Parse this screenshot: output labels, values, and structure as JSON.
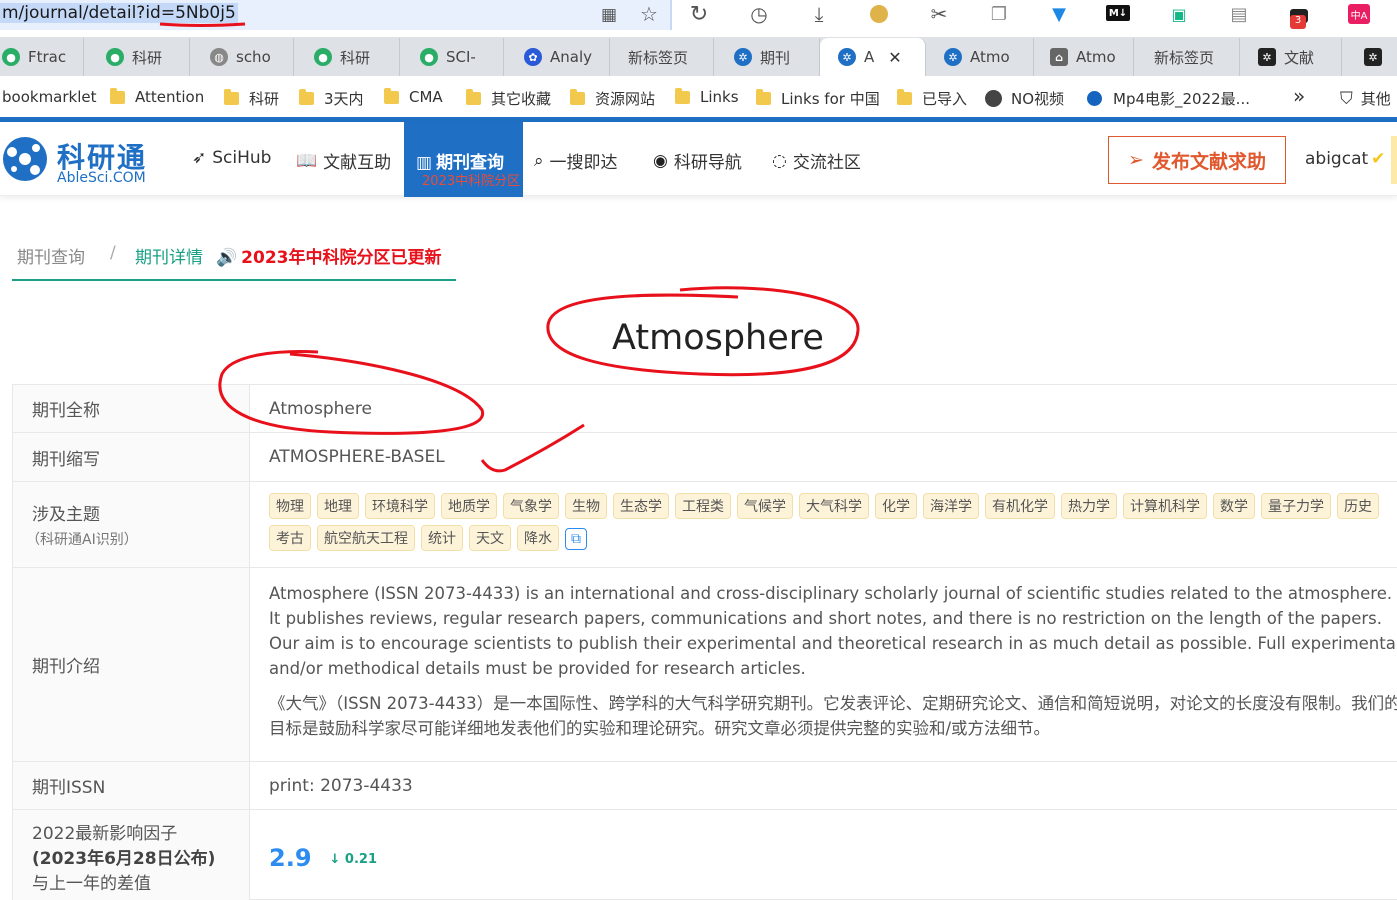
{
  "browser": {
    "url": "m/journal/detail?id=5Nb0j5",
    "tabs": [
      {
        "label": "Ftrac",
        "icon": "wechat-icon"
      },
      {
        "label": "科研",
        "icon": "wechat-icon"
      },
      {
        "label": "scho",
        "icon": "globe-icon"
      },
      {
        "label": "科研",
        "icon": "wechat-icon"
      },
      {
        "label": "SCI-",
        "icon": "wechat-icon"
      },
      {
        "label": "Analy",
        "icon": "baidu-icon"
      },
      {
        "label": "新标签页",
        "icon": ""
      },
      {
        "label": "期刊",
        "icon": "ablesci-icon"
      },
      {
        "label": "A",
        "icon": "ablesci-icon"
      },
      {
        "label": "Atmo",
        "icon": "ablesci-icon"
      },
      {
        "label": "Atmo",
        "icon": "lock-icon"
      },
      {
        "label": "新标签页",
        "icon": ""
      },
      {
        "label": "文献",
        "icon": "ablesci-icon"
      },
      {
        "label": "",
        "icon": "ablesci-icon"
      }
    ],
    "bookmarks": [
      {
        "label": "bookmarklet",
        "icon": ""
      },
      {
        "label": "Attention",
        "icon": "folder-icon"
      },
      {
        "label": "科研",
        "icon": "folder-icon"
      },
      {
        "label": "3天内",
        "icon": "folder-icon"
      },
      {
        "label": "CMA",
        "icon": "folder-icon"
      },
      {
        "label": "其它收藏",
        "icon": "folder-icon"
      },
      {
        "label": "资源网站",
        "icon": "folder-icon"
      },
      {
        "label": "Links",
        "icon": "folder-icon"
      },
      {
        "label": "Links for 中国",
        "icon": "folder-icon"
      },
      {
        "label": "已导入",
        "icon": "folder-icon"
      },
      {
        "label": "NO视频",
        "icon": "globe-icon"
      },
      {
        "label": "Mp4电影_2022最...",
        "icon": "globe-icon"
      },
      {
        "label": "其他",
        "icon": "folder-icon"
      }
    ]
  },
  "site": {
    "logo_cn": "科研通",
    "logo_en": "AbleSci.COM",
    "nav": [
      {
        "label": "SciHub",
        "icon": "bird-icon"
      },
      {
        "label": "文献互助",
        "icon": "book-icon"
      },
      {
        "label": "期刊查询",
        "sub": "2023中科院分区",
        "icon": "journal-icon"
      },
      {
        "label": "一搜即达",
        "icon": "search-icon"
      },
      {
        "label": "科研导航",
        "icon": "compass-icon"
      },
      {
        "label": "交流社区",
        "icon": "chat-icon"
      }
    ],
    "post_button": "发布文献求助",
    "username": "abigcat"
  },
  "breadcrumb": {
    "home": "期刊查询",
    "sep": "/",
    "current": "期刊详情",
    "notice": "2023年中科院分区已更新"
  },
  "journal": {
    "title": "Atmosphere",
    "rows": {
      "fullname_label": "期刊全称",
      "fullname": "Atmosphere",
      "abbr_label": "期刊缩写",
      "abbr": "ATMOSPHERE-BASEL",
      "topics_label": "涉及主题",
      "topics_sublabel": "（科研通AI识别）",
      "topics": [
        "物理",
        "地理",
        "环境科学",
        "地质学",
        "气象学",
        "生物",
        "生态学",
        "工程类",
        "气候学",
        "大气科学",
        "化学",
        "海洋学",
        "有机化学",
        "热力学",
        "计算机科学",
        "数学",
        "量子力学",
        "历史",
        "考古",
        "航空航天工程",
        "统计",
        "天文",
        "降水"
      ],
      "intro_label": "期刊介绍",
      "intro_en": "Atmosphere (ISSN 2073-4433) is an international and cross-disciplinary scholarly journal of scientific studies related to the atmosphere. It publishes reviews, regular research papers, communications and short notes, and there is no restriction on the length of the papers. Our aim is to encourage scientists to publish their experimental and theoretical research in as much detail as possible. Full experimental and/or methodical details must be provided for research articles.",
      "intro_cn": "《大气》（ISSN 2073-4433）是一本国际性、跨学科的大气科学研究期刊。它发表评论、定期研究论文、通信和简短说明，对论文的长度没有限制。我们的目标是鼓励科学家尽可能详细地发表他们的实验和理论研究。研究文章必须提供完整的实验和/或方法细节。",
      "issn_label": "期刊ISSN",
      "issn": "print: 2073-4433",
      "if_label_1": "2022最新影响因子",
      "if_label_2": "(2023年6月28日公布)",
      "if_label_3": "与上一年的差值",
      "if_value": "2.9",
      "if_delta": "↓ 0.21"
    }
  },
  "colors": {
    "brand_blue": "#1f6fc5",
    "accent_red": "#e0582e",
    "teal": "#19a085",
    "annotation": "#e8111b"
  }
}
